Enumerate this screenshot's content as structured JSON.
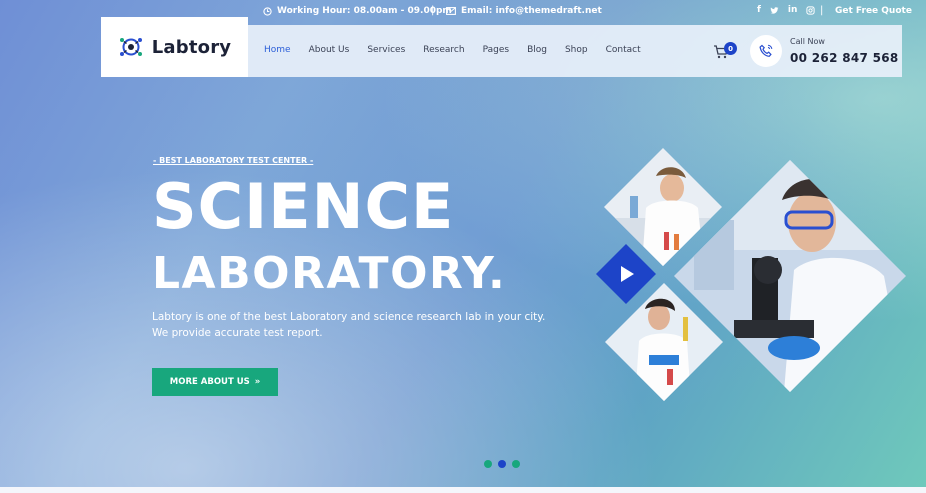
{
  "topbar": {
    "working_hours": "Working Hour: 08.00am - 09.00pm",
    "separator": "|",
    "email": "Email: info@themedraft.net",
    "separator2": "|",
    "social": [
      "f",
      "t",
      "in",
      "ig"
    ],
    "quote_link": "Get Free Quote"
  },
  "header": {
    "logo_text": "Labtory",
    "nav": [
      "Home",
      "About Us",
      "Services",
      "Research",
      "Pages",
      "Blog",
      "Shop",
      "Contact"
    ],
    "active_nav": "Home",
    "cart_count": "0",
    "call_label": "Call Now",
    "call_number": "00 262 847 568"
  },
  "hero": {
    "eyebrow": "- BEST LABORATORY TEST CENTER -",
    "title_line1": "SCIENCE",
    "title_line2": "LABORATORY.",
    "description_line1": "Labtory is one of the best Laboratory and science research lab in your city.",
    "description_line2": "We provide accurate test report.",
    "cta_label": "MORE ABOUT US",
    "cta_icon": "»"
  },
  "slider": {
    "dot_count": 3,
    "active_dot": 2
  },
  "colors": {
    "accent_green": "#18a77d",
    "accent_blue": "#1d44c8",
    "nav_active": "#2c5fd8"
  }
}
